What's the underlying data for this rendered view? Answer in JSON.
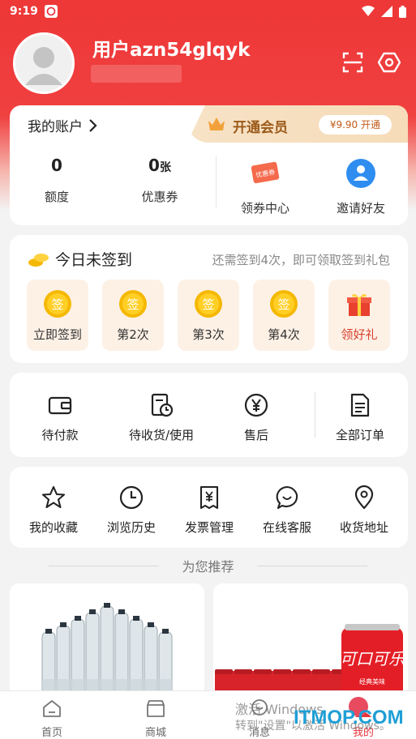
{
  "status_bar": {
    "time": "9:19"
  },
  "profile": {
    "username": "用户azn54glqyk"
  },
  "account": {
    "title": "我的账户",
    "vip_label": "开通会员",
    "vip_button": "¥9.90 开通",
    "stats": [
      {
        "value": "0",
        "unit": "",
        "label": "额度"
      },
      {
        "value": "0",
        "unit": "张",
        "label": "优惠券"
      }
    ],
    "quick_links": [
      {
        "label": "领券中心",
        "icon": "coupon-center-icon",
        "badge": "优惠券"
      },
      {
        "label": "邀请好友",
        "icon": "invite-friend-icon"
      }
    ]
  },
  "checkin": {
    "title": "今日未签到",
    "hint": "还需签到4次，即可领取签到礼包",
    "coin_glyph": "签",
    "days": [
      {
        "label": "立即签到"
      },
      {
        "label": "第2次"
      },
      {
        "label": "第3次"
      },
      {
        "label": "第4次"
      },
      {
        "label": "领好礼"
      }
    ]
  },
  "orders": {
    "items": [
      {
        "label": "待付款",
        "icon": "wallet-icon"
      },
      {
        "label": "待收货/使用",
        "icon": "receipt-clock-icon"
      },
      {
        "label": "售后",
        "icon": "yen-circle-icon"
      },
      {
        "label": "全部订单",
        "icon": "document-icon"
      }
    ]
  },
  "tools": {
    "items": [
      {
        "label": "我的收藏",
        "icon": "star-icon"
      },
      {
        "label": "浏览历史",
        "icon": "clock-icon"
      },
      {
        "label": "发票管理",
        "icon": "invoice-icon"
      },
      {
        "label": "在线客服",
        "icon": "chat-smile-icon"
      },
      {
        "label": "收货地址",
        "icon": "location-pin-icon"
      }
    ]
  },
  "recommend": {
    "title": "为您推荐"
  },
  "products": [
    {
      "name": "bottled-water-pack"
    },
    {
      "name": "cola-can-pack",
      "can_text": "可口可乐",
      "can_sub": "经典美味"
    }
  ],
  "bottom_nav": [
    {
      "label": "首页",
      "icon": "home-icon",
      "active": false
    },
    {
      "label": "商城",
      "icon": "store-icon",
      "active": false
    },
    {
      "label": "消息",
      "icon": "message-icon",
      "active": false
    },
    {
      "label": "我的",
      "icon": "user-icon",
      "active": true
    }
  ],
  "overlay": {
    "activate_line1": "激活 Windows",
    "activate_line2": "转到\"设置\"以激活 Windows。",
    "site_logo": "ITMOP.COM"
  },
  "colors": {
    "brand_red": "#ee3737",
    "vip_gold": "#9b5a1a",
    "coin_gold": "#f5b800"
  }
}
